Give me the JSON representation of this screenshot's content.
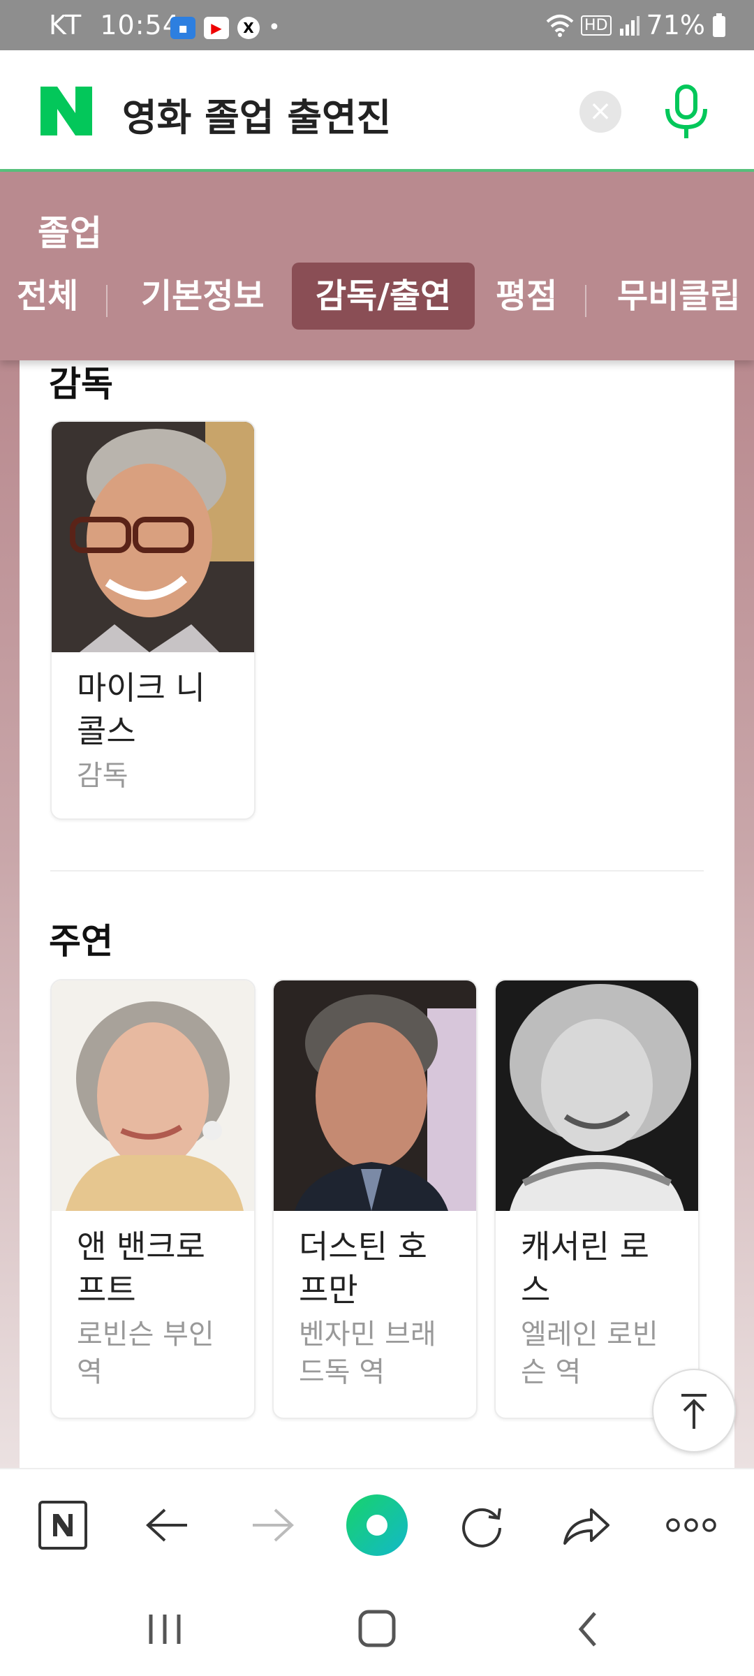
{
  "status_bar": {
    "carrier": "KT",
    "time": "10:54",
    "dot": "•",
    "network": "HD",
    "battery_percent": "71%"
  },
  "search": {
    "query": "영화 졸업 출연진",
    "clear_symbol": "×"
  },
  "section": {
    "title": "졸업",
    "tabs": [
      {
        "label": "전체",
        "active": false
      },
      {
        "label": "기본정보",
        "active": false
      },
      {
        "label": "감독/출연",
        "active": true
      },
      {
        "label": "평점",
        "active": false
      },
      {
        "label": "무비클립",
        "active": false
      }
    ]
  },
  "director_section": {
    "heading": "감독",
    "people": [
      {
        "name_line1": "마이크 니",
        "name_line2": "콜스",
        "role": "감독"
      }
    ]
  },
  "cast_section": {
    "heading": "주연",
    "people": [
      {
        "name_line1": "앤 밴크로",
        "name_line2": "프트",
        "role_line1": "로빈슨 부인",
        "role_line2": "역"
      },
      {
        "name_line1": "더스틴 호",
        "name_line2": "프만",
        "role_line1": "벤자민 브래",
        "role_line2": "드독 역"
      },
      {
        "name_line1": "캐서린 로",
        "name_line2": "스",
        "role_line1": "엘레인 로빈",
        "role_line2": "슨 역"
      }
    ]
  },
  "colors": {
    "naver_green": "#03c75a",
    "mauve": "#b98a8f",
    "active_tab": "#8a4e55"
  }
}
